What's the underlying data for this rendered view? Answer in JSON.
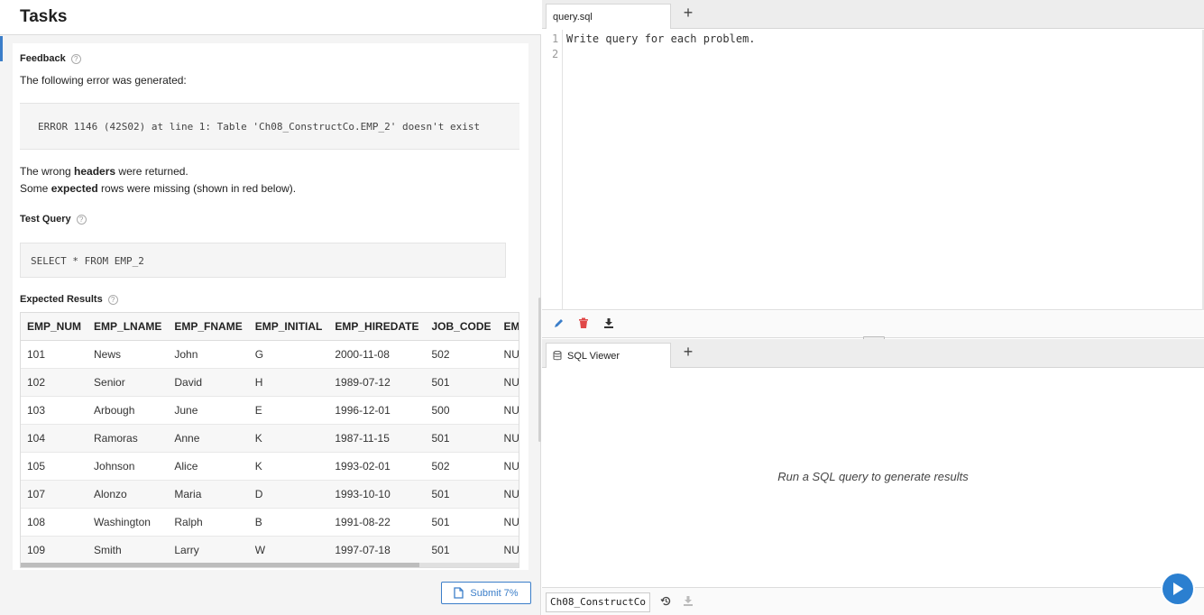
{
  "tasks": {
    "title": "Tasks",
    "feedback_label": "Feedback",
    "feedback_text": "The following error was generated:",
    "error_message": "ERROR 1146 (42S02) at line 1: Table 'Ch08_ConstructCo.EMP_2' doesn't exist",
    "headers_line": {
      "prefix": "The wrong ",
      "bold": "headers",
      "suffix": " were returned."
    },
    "rows_line": {
      "prefix": "Some ",
      "bold": "expected",
      "suffix": " rows were missing (shown in red below)."
    },
    "test_query_label": "Test Query",
    "test_query": "SELECT * FROM EMP_2",
    "expected_label": "Expected Results",
    "submit_label": "Submit 7%"
  },
  "table": {
    "columns": [
      "EMP_NUM",
      "EMP_LNAME",
      "EMP_FNAME",
      "EMP_INITIAL",
      "EMP_HIREDATE",
      "JOB_CODE",
      "EMP_"
    ],
    "rows": [
      [
        "101",
        "News",
        "John",
        "G",
        "2000-11-08",
        "502",
        "NULL"
      ],
      [
        "102",
        "Senior",
        "David",
        "H",
        "1989-07-12",
        "501",
        "NULL"
      ],
      [
        "103",
        "Arbough",
        "June",
        "E",
        "1996-12-01",
        "500",
        "NULL"
      ],
      [
        "104",
        "Ramoras",
        "Anne",
        "K",
        "1987-11-15",
        "501",
        "NULL"
      ],
      [
        "105",
        "Johnson",
        "Alice",
        "K",
        "1993-02-01",
        "502",
        "NULL"
      ],
      [
        "107",
        "Alonzo",
        "Maria",
        "D",
        "1993-10-10",
        "501",
        "NULL"
      ],
      [
        "108",
        "Washington",
        "Ralph",
        "B",
        "1991-08-22",
        "501",
        "NULL"
      ],
      [
        "109",
        "Smith",
        "Larry",
        "W",
        "1997-07-18",
        "501",
        "NULL"
      ]
    ]
  },
  "editor": {
    "tab_label": "query.sql",
    "add_tab": "+",
    "line_numbers": [
      "1",
      "2"
    ],
    "code_line_1": "Write query for each problem."
  },
  "viewer": {
    "tab_label": "SQL Viewer",
    "add_tab": "+",
    "empty_message": "Run a SQL query to generate results",
    "database": "Ch08_ConstructCo"
  },
  "colors": {
    "accent": "#3b7ec9",
    "delete": "#e04848",
    "run": "#2b7fd0"
  },
  "icons": [
    "help-icon",
    "file-icon",
    "pencil-icon",
    "trash-icon",
    "download-icon",
    "database-icon",
    "history-icon",
    "play-icon"
  ]
}
